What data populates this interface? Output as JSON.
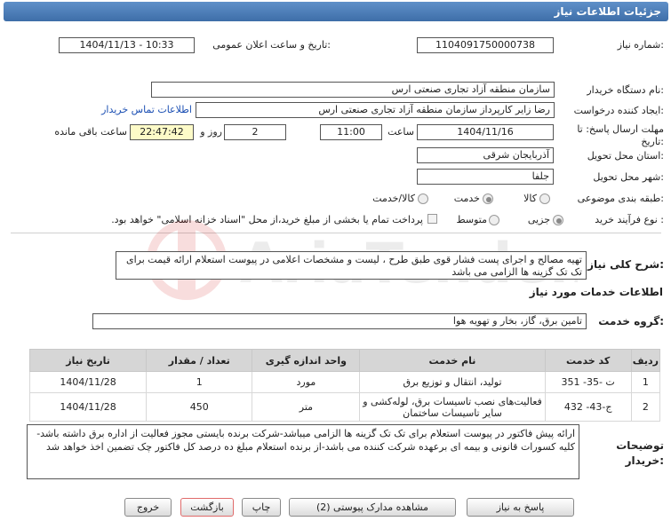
{
  "title": "جزئیات اطلاعات نیاز",
  "need_number": {
    "label": "شماره نیاز:",
    "value": "1104091750000738"
  },
  "announce": {
    "label": "تاریخ و ساعت اعلان عمومی:",
    "value": "1404/11/13 - 10:33"
  },
  "buyer": {
    "label": "نام دستگاه خریدار:",
    "value": "سازمان منطقه آزاد تجاری صنعتی ارس"
  },
  "creator": {
    "label": "ایجاد کننده درخواست:",
    "value": "رضا زایر کارپرداز سازمان منطقه آزاد تجاری صنعتی ارس",
    "contact_link": "اطلاعات تماس خریدار"
  },
  "deadline": {
    "label": "مهلت ارسال پاسخ: تا تاریخ:",
    "date": "1404/11/16",
    "time_label": "ساعت",
    "time": "11:00",
    "days": "2",
    "days_label": "روز و",
    "remaining": "22:47:42",
    "remaining_label": "ساعت باقی مانده"
  },
  "province": {
    "label": "استان محل تحویل:",
    "value": "آذربایجان شرقی"
  },
  "city": {
    "label": "شهر محل تحویل:",
    "value": "جلفا"
  },
  "category": {
    "label": "طبقه بندی موضوعی:",
    "options": [
      "کالا",
      "خدمت",
      "کالا/خدمت"
    ],
    "selected": "خدمت"
  },
  "purchase_type": {
    "label": "نوع فرآیند خرید :",
    "options": [
      "جزیی",
      "متوسط"
    ],
    "selected": "جزیی",
    "note": "پرداخت تمام یا بخشی از مبلغ خرید،از محل \"اسناد خزانه اسلامی\" خواهد بود."
  },
  "description": {
    "label": "شرح کلی نیاز:",
    "value": "تهیه مصالح و اجرای پست فشار قوی طبق طرح ، لیست و مشخصات اعلامی در پیوست استعلام ارائه قیمت برای تک تک گزینه ها الزامی می باشد"
  },
  "services_header": "اطلاعات خدمات مورد نیاز",
  "service_group": {
    "label": "گروه خدمت:",
    "value": "تامین برق، گاز، بخار و تهویه هوا"
  },
  "table": {
    "headers": [
      "ردیف",
      "کد خدمت",
      "نام خدمت",
      "واحد اندازه گیری",
      "تعداد / مقدار",
      "تاریخ نیاز"
    ],
    "rows": [
      [
        "1",
        "ت -35- 351",
        "تولید، انتقال و توزیع برق",
        "مورد",
        "1",
        "1404/11/28"
      ],
      [
        "2",
        "ج-43- 432",
        "فعالیت‌های نصب تاسیسات برق، لوله‌کشی و سایر تاسیسات ساختمان",
        "متر",
        "450",
        "1404/11/28"
      ]
    ]
  },
  "buyer_notes": {
    "label": "توضیحات خریدار:",
    "value": "ارائه پیش فاکتور در پیوست استعلام برای تک تک گزینه ها الزامی میباشد-شرکت برنده بایستی مجوز فعالیت از اداره برق داشته باشد-کلیه کسورات قانونی و بیمه ای برعهده شرکت کننده می باشد-از برنده استعلام مبلغ ده درصد کل فاکتور چک تضمین اخذ خواهد شد"
  },
  "buttons": {
    "reply": "پاسخ به نیاز",
    "attachments": "مشاهده مدارک پیوستی (2)",
    "print": "چاپ",
    "back": "بازگشت",
    "exit": "خروج"
  },
  "watermark": "AriaTender.net"
}
